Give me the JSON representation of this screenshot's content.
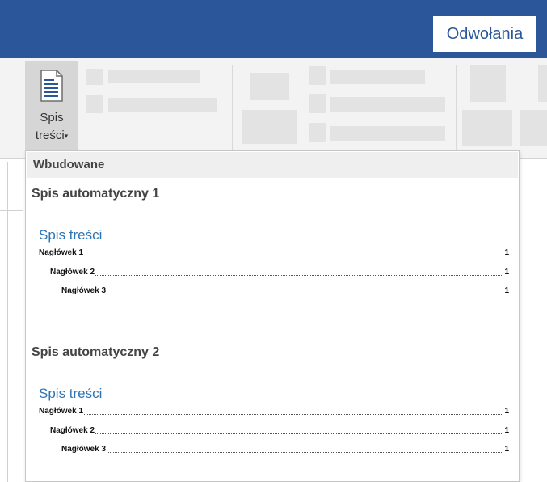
{
  "ribbon": {
    "active_tab": "Odwołania",
    "toc_button": {
      "line1": "Spis",
      "line2": "treści",
      "caret": "▾"
    }
  },
  "dropdown": {
    "section_header": "Wbudowane",
    "items": [
      {
        "title": "Spis automatyczny 1",
        "preview_title": "Spis treści",
        "entries": [
          {
            "label": "Nagłówek 1",
            "page": "1"
          },
          {
            "label": "Nagłówek 2",
            "page": "1"
          },
          {
            "label": "Nagłówek 3",
            "page": "1"
          }
        ]
      },
      {
        "title": "Spis automatyczny 2",
        "preview_title": "Spis treści",
        "entries": [
          {
            "label": "Nagłówek 1",
            "page": "1"
          },
          {
            "label": "Nagłówek 2",
            "page": "1"
          },
          {
            "label": "Nagłówek 3",
            "page": "1"
          }
        ]
      }
    ]
  },
  "colors": {
    "title_bar": "#2b579a",
    "heading_blue": "#2e74b5"
  },
  "icons": {
    "toc": "document-lines-icon"
  }
}
